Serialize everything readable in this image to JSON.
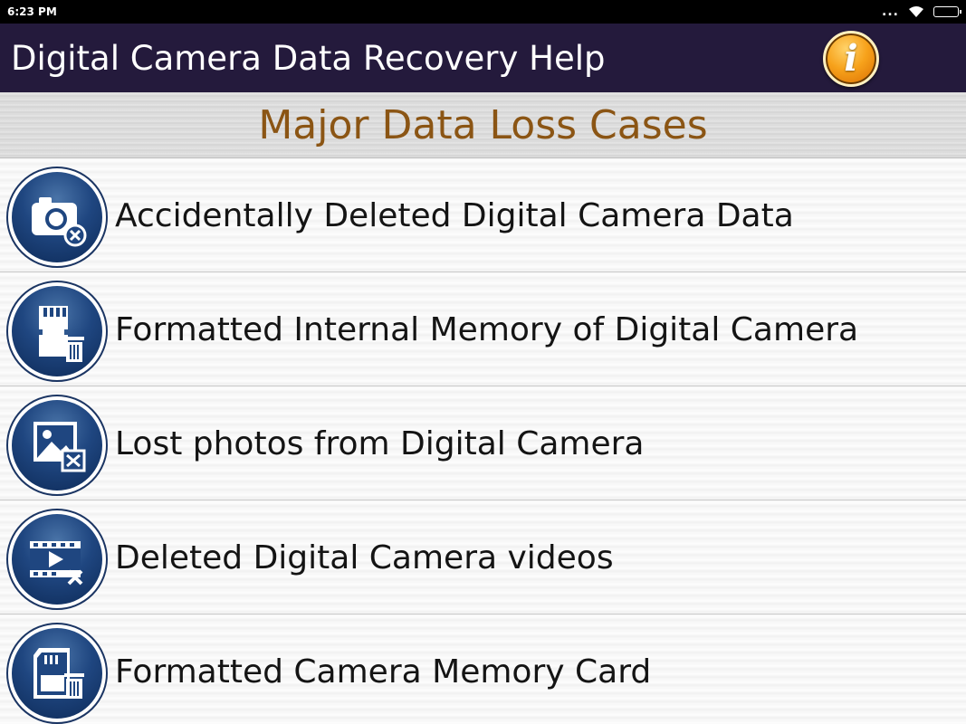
{
  "status_bar": {
    "time": "6:23 PM",
    "dots": "..."
  },
  "app_bar": {
    "title": "Digital Camera Data Recovery Help",
    "info_glyph": "i"
  },
  "section": {
    "title": "Major Data Loss Cases"
  },
  "cases": [
    {
      "label": "Accidentally Deleted Digital Camera Data",
      "icon": "camera-delete-icon"
    },
    {
      "label": "Formatted Internal Memory of Digital Camera",
      "icon": "memory-card-trash-icon"
    },
    {
      "label": "Lost photos from Digital Camera",
      "icon": "photo-delete-icon"
    },
    {
      "label": "Deleted Digital Camera videos",
      "icon": "video-delete-icon"
    },
    {
      "label": "Formatted Camera Memory Card",
      "icon": "sd-card-trash-icon"
    }
  ],
  "colors": {
    "app_bar": "#241a3c",
    "section_title": "#8b5514",
    "info_button": "#f7a21b",
    "icon_blue": "#1f4680"
  }
}
